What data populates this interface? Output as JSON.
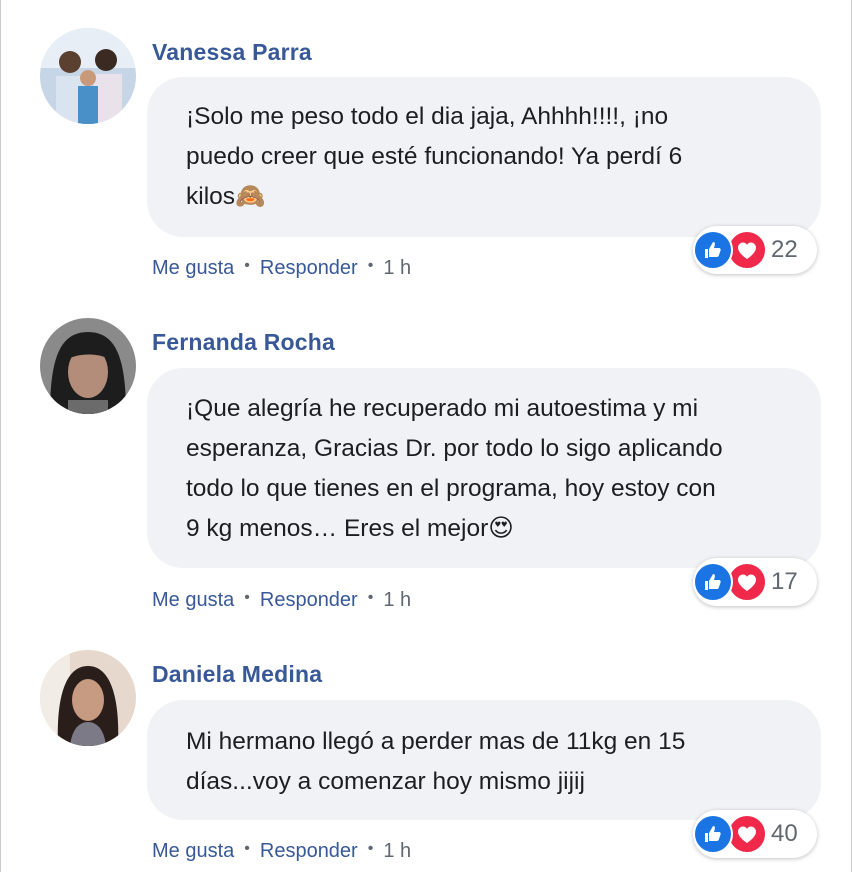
{
  "comments": [
    {
      "author": "Vanessa Parra",
      "text": "¡Solo me peso todo el dia jaja, Ahhhh!!!!, ¡no\npuedo creer que esté funcionando! Ya perdí 6\nkilos🙈",
      "reaction_count": "22",
      "actions": {
        "like": "Me gusta",
        "reply": "Responder",
        "time": "1 h"
      }
    },
    {
      "author": "Fernanda Rocha",
      "text": "¡Que alegría he recuperado mi autoestima y mi\nesperanza, Gracias Dr. por todo lo sigo aplicando\ntodo lo que tienes en el programa, hoy estoy con\n9 kg menos… Eres el mejor😍",
      "reaction_count": "17",
      "actions": {
        "like": "Me gusta",
        "reply": "Responder",
        "time": "1 h"
      }
    },
    {
      "author": "Daniela Medina",
      "text": "Mi hermano llegó a perder mas de 11kg en 15\ndías...voy a comenzar hoy mismo jijij",
      "reaction_count": "40",
      "actions": {
        "like": "Me gusta",
        "reply": "Responder",
        "time": "1 h"
      }
    }
  ],
  "icons": {
    "like": "thumbs-up-icon",
    "love": "heart-icon"
  },
  "colors": {
    "author": "#385898",
    "bubble": "#f0f2f5",
    "like": "#1b74e4",
    "love": "#f0284a"
  }
}
